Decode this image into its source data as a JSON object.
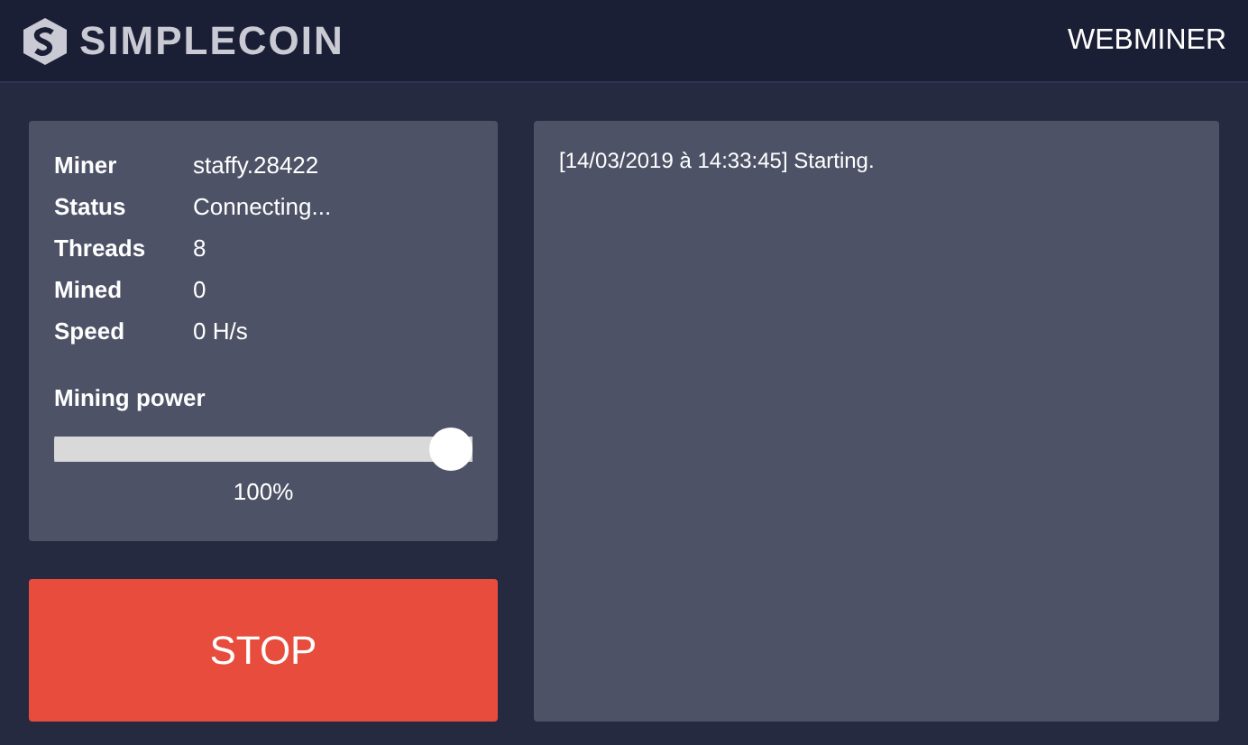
{
  "header": {
    "logo": "SIMPLECOIN",
    "title": "WEBMINER"
  },
  "stats": [
    {
      "label": "Miner",
      "value": "staffy.28422"
    },
    {
      "label": "Status",
      "value": "Connecting..."
    },
    {
      "label": "Threads",
      "value": "8"
    },
    {
      "label": "Mined",
      "value": "0"
    },
    {
      "label": "Speed",
      "value": "0 H/s"
    }
  ],
  "power": {
    "label": "Mining power",
    "level": 1,
    "reading": "100%"
  },
  "stop_button": "STOP",
  "log": [
    "[14/03/2019 à 14:33:45] Starting."
  ]
}
